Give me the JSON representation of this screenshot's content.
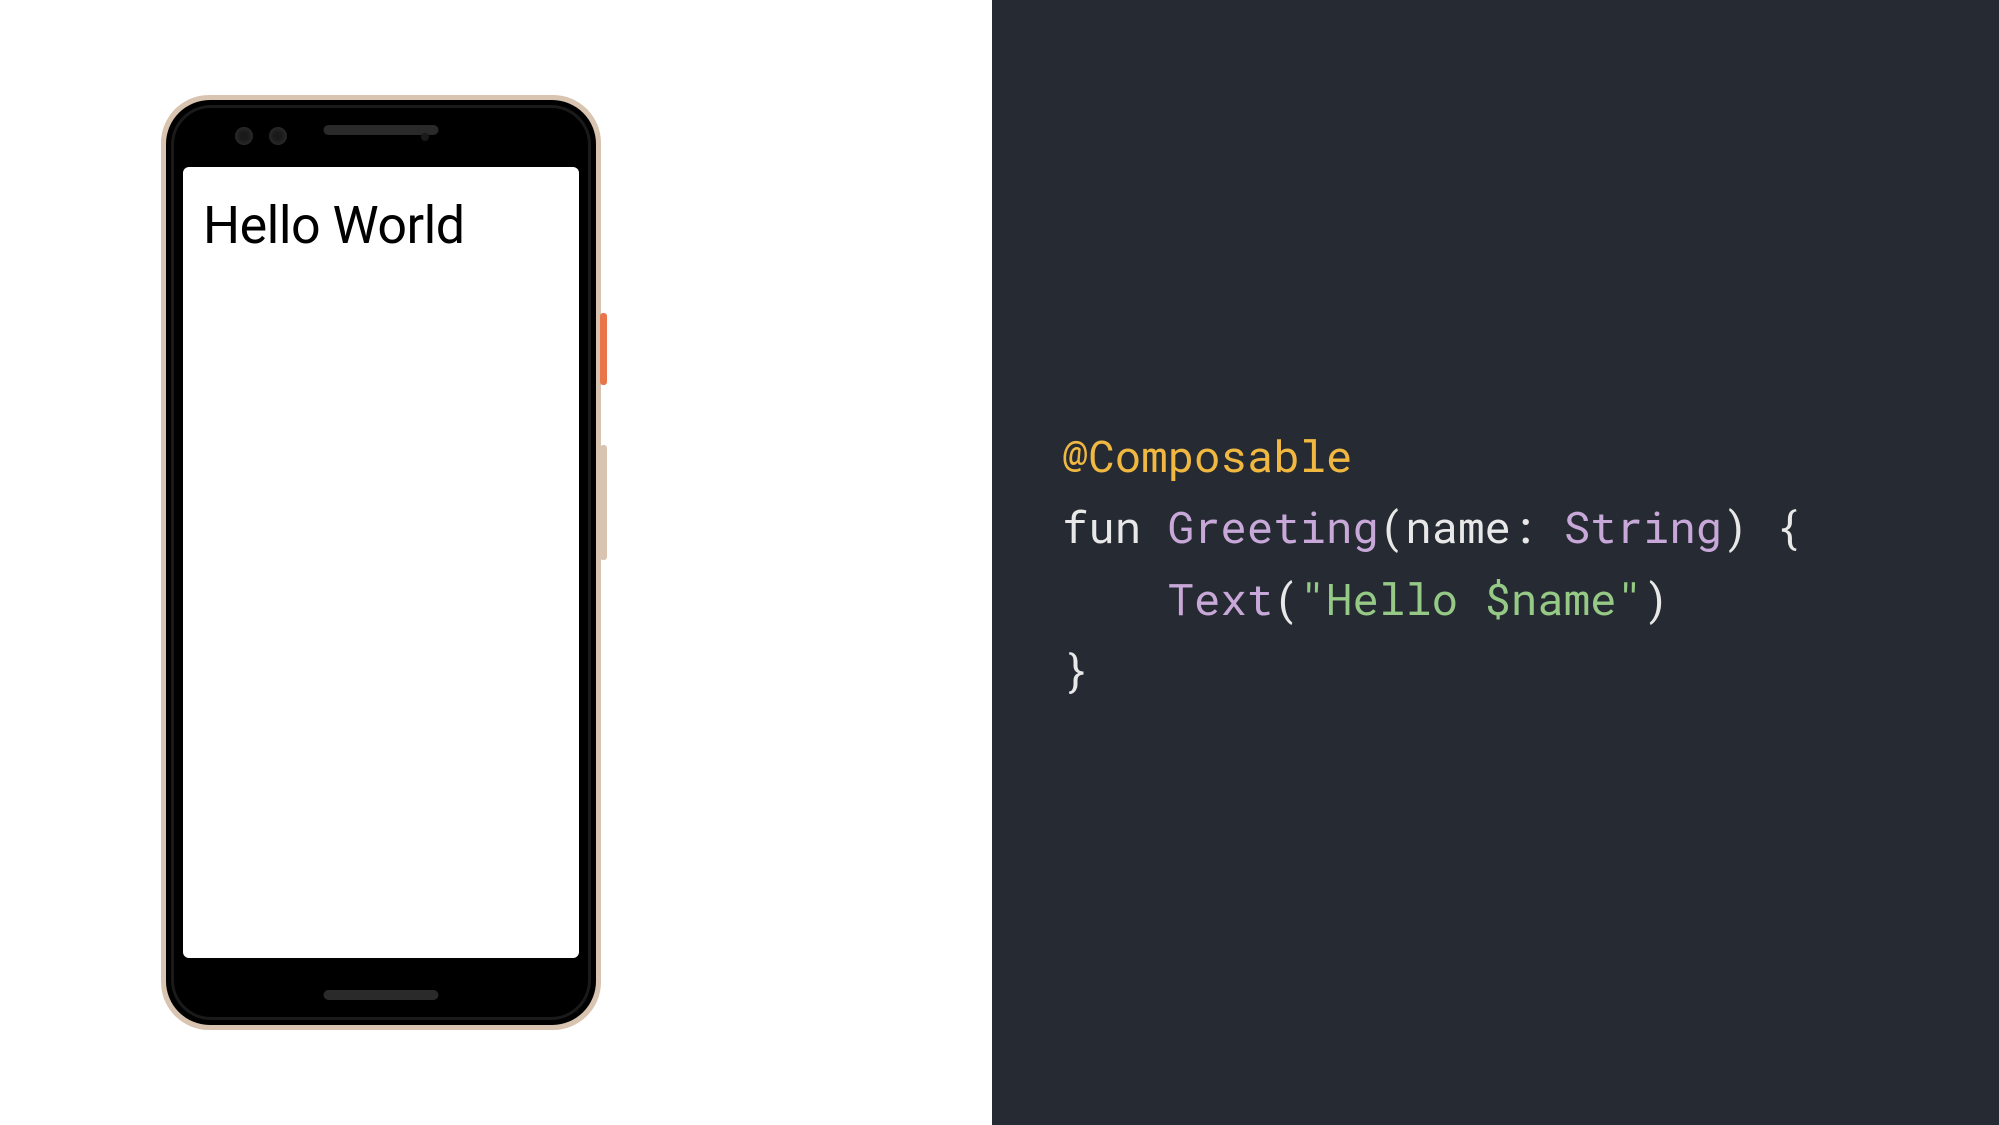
{
  "phone": {
    "screen_text": "Hello World"
  },
  "code": {
    "annotation": "@Composable",
    "kw_fun": "fun",
    "func_name": "Greeting",
    "paren_open": "(",
    "param_name": "name",
    "colon": ": ",
    "type": "String",
    "paren_close": ")",
    "brace_open": " {",
    "indent": "    ",
    "text_call": "Text",
    "call_open": "(",
    "string": "\"Hello $name\"",
    "call_close": ")",
    "brace_close": "}"
  }
}
